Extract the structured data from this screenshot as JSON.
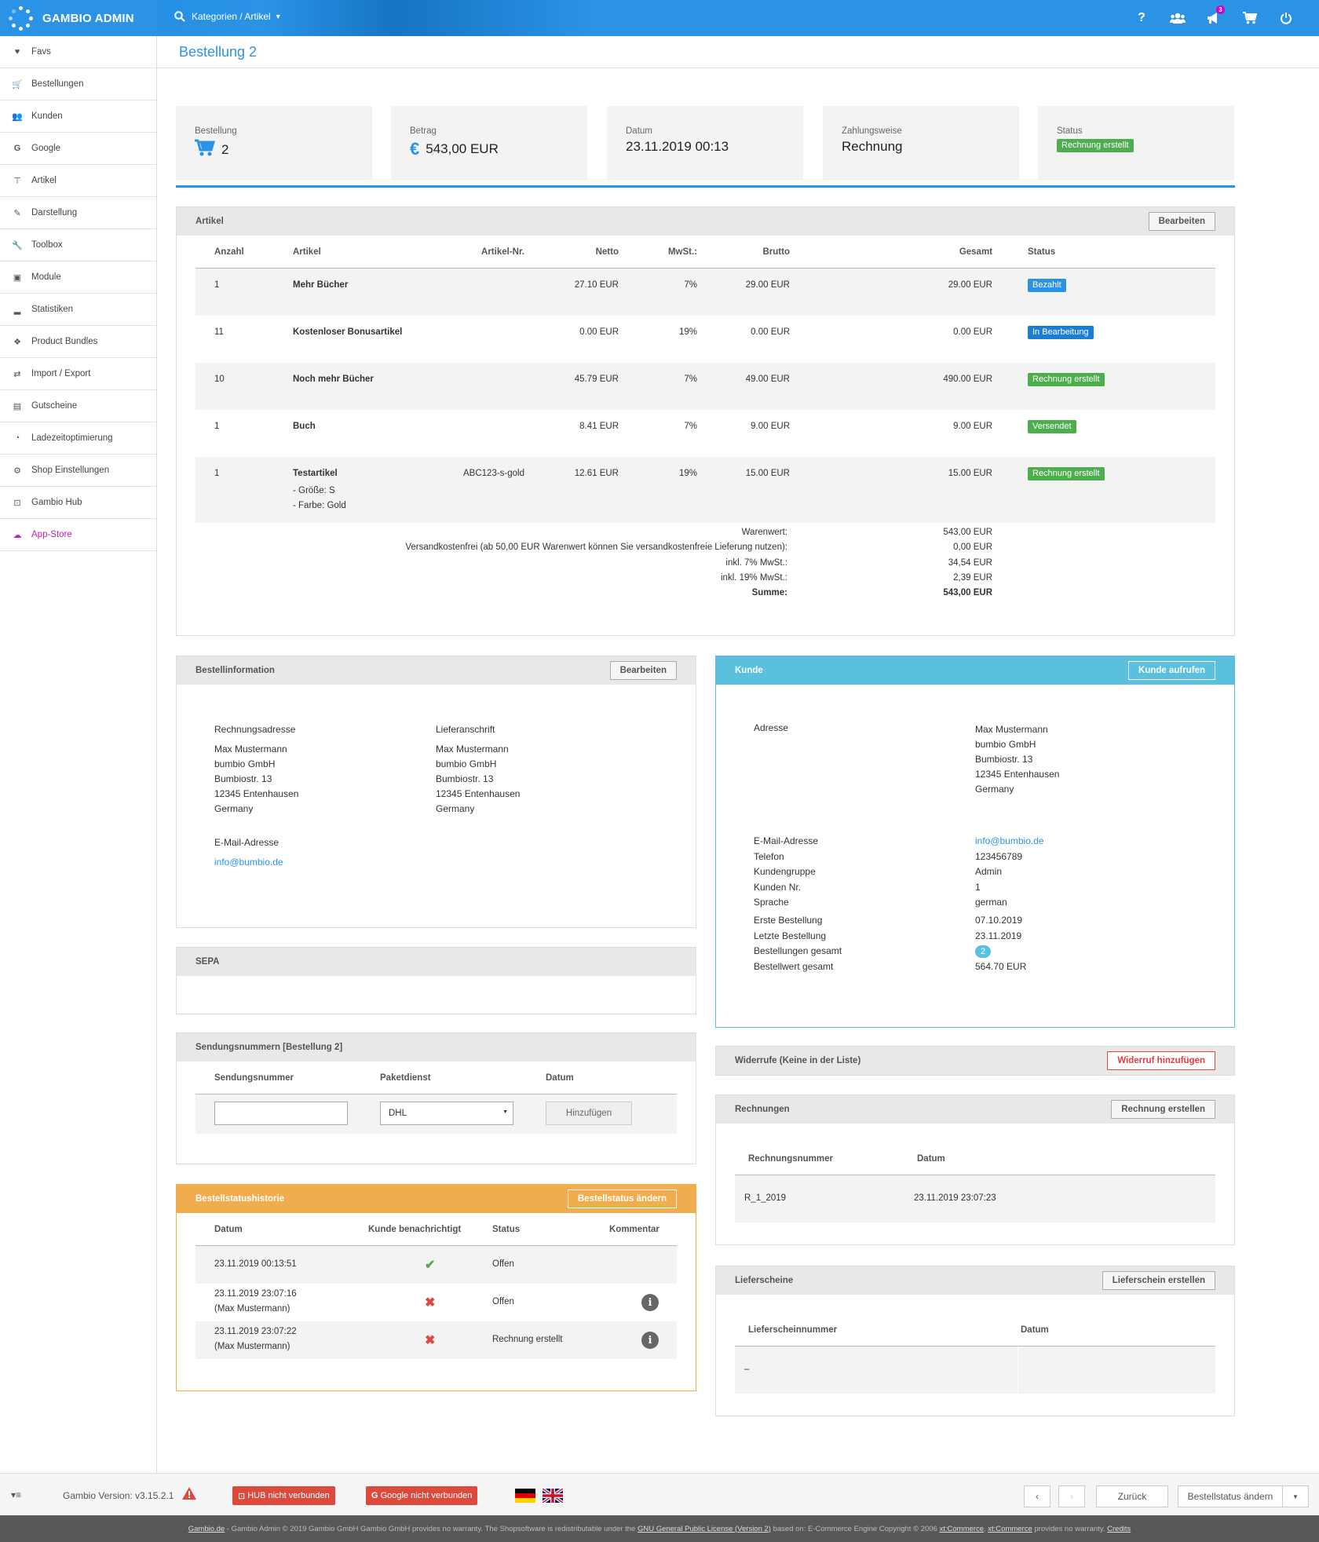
{
  "topbar": {
    "brand": "GAMBIO ADMIN",
    "search_label": "Kategorien / Artikel",
    "notification_count": "3"
  },
  "sidebar": {
    "items": [
      {
        "label": "Favs",
        "icon": "heart-icon"
      },
      {
        "label": "Bestellungen",
        "icon": "cart-icon"
      },
      {
        "label": "Kunden",
        "icon": "users-icon"
      },
      {
        "label": "Google",
        "icon": "google-icon"
      },
      {
        "label": "Artikel",
        "icon": "sitemap-icon"
      },
      {
        "label": "Darstellung",
        "icon": "magic-icon"
      },
      {
        "label": "Toolbox",
        "icon": "wrench-icon"
      },
      {
        "label": "Module",
        "icon": "puzzle-icon"
      },
      {
        "label": "Statistiken",
        "icon": "chart-icon"
      },
      {
        "label": "Product Bundles",
        "icon": "cubes-icon"
      },
      {
        "label": "Import / Export",
        "icon": "exchange-icon"
      },
      {
        "label": "Gutscheine",
        "icon": "gift-icon"
      },
      {
        "label": "Ladezeitoptimierung",
        "icon": "dashboard-icon"
      },
      {
        "label": "Shop Einstellungen",
        "icon": "gears-icon"
      },
      {
        "label": "Gambio Hub",
        "icon": "hub-icon"
      },
      {
        "label": "App-Store",
        "icon": "cloud-download-icon"
      }
    ]
  },
  "page": {
    "title": "Bestellung 2"
  },
  "stats": {
    "bestellung": {
      "label": "Bestellung",
      "value": "2"
    },
    "betrag": {
      "label": "Betrag",
      "value": "543,00 EUR"
    },
    "datum": {
      "label": "Datum",
      "value": "23.11.2019 00:13"
    },
    "zahlungsweise": {
      "label": "Zahlungsweise",
      "value": "Rechnung"
    },
    "status": {
      "label": "Status",
      "value": "Rechnung erstellt"
    }
  },
  "artikel": {
    "title": "Artikel",
    "edit_label": "Bearbeiten",
    "headers": {
      "anzahl": "Anzahl",
      "artikel": "Artikel",
      "nr": "Artikel-Nr.",
      "netto": "Netto",
      "mwst": "MwSt.:",
      "brutto": "Brutto",
      "gesamt": "Gesamt",
      "status": "Status"
    },
    "rows": [
      {
        "anzahl": "1",
        "artikel": "Mehr Bücher",
        "nr": "",
        "netto": "27.10 EUR",
        "mwst": "7%",
        "brutto": "29.00 EUR",
        "gesamt": "29.00 EUR",
        "status": "Bezahlt"
      },
      {
        "anzahl": "11",
        "artikel": "Kostenloser Bonusartikel",
        "nr": "",
        "netto": "0.00 EUR",
        "mwst": "19%",
        "brutto": "0.00 EUR",
        "gesamt": "0.00 EUR",
        "status": "In Bearbeitung"
      },
      {
        "anzahl": "10",
        "artikel": "Noch mehr Bücher",
        "nr": "",
        "netto": "45.79 EUR",
        "mwst": "7%",
        "brutto": "49.00 EUR",
        "gesamt": "490.00 EUR",
        "status": "Rechnung erstellt"
      },
      {
        "anzahl": "1",
        "artikel": "Buch",
        "nr": "",
        "netto": "8.41 EUR",
        "mwst": "7%",
        "brutto": "9.00 EUR",
        "gesamt": "9.00 EUR",
        "status": "Versendet"
      },
      {
        "anzahl": "1",
        "artikel": "Testartikel",
        "nr": "ABC123-s-gold",
        "netto": "12.61 EUR",
        "mwst": "19%",
        "brutto": "15.00 EUR",
        "gesamt": "15.00 EUR",
        "status": "Rechnung erstellt",
        "opt1": "- Größe: S",
        "opt2": "- Farbe: Gold"
      }
    ],
    "totals": [
      {
        "label": "Warenwert:",
        "value": "543,00 EUR"
      },
      {
        "label": "Versandkostenfrei (ab 50,00 EUR Warenwert können Sie versandkostenfreie Lieferung nutzen):",
        "value": "0,00 EUR"
      },
      {
        "label": "inkl. 7% MwSt.:",
        "value": "34,54 EUR"
      },
      {
        "label": "inkl. 19% MwSt.:",
        "value": "2,39 EUR"
      },
      {
        "label": "Summe:",
        "value": "543,00 EUR"
      }
    ]
  },
  "bestellinfo": {
    "title": "Bestellinformation",
    "edit_label": "Bearbeiten",
    "rechnung_label": "Rechnungsadresse",
    "rechnung": [
      "Max Mustermann",
      "bumbio GmbH",
      "Bumbiostr. 13",
      "12345 Entenhausen",
      "Germany"
    ],
    "liefer_label": "Lieferanschrift",
    "liefer": [
      "Max Mustermann",
      "bumbio GmbH",
      "Bumbiostr. 13",
      "12345 Entenhausen",
      "Germany"
    ],
    "email_label": "E-Mail-Adresse",
    "email": "info@bumbio.de"
  },
  "kunde": {
    "title": "Kunde",
    "button": "Kunde aufrufen",
    "adresse_label": "Adresse",
    "adresse": [
      "Max Mustermann",
      "bumbio GmbH",
      "Bumbiostr. 13",
      "12345 Entenhausen",
      "Germany"
    ],
    "fields1": [
      {
        "label": "E-Mail-Adresse",
        "value": "info@bumbio.de"
      },
      {
        "label": "Telefon",
        "value": "123456789"
      },
      {
        "label": "Kundengruppe",
        "value": "Admin"
      },
      {
        "label": "Kunden Nr.",
        "value": "1"
      },
      {
        "label": "Sprache",
        "value": "german"
      }
    ],
    "fields2": [
      {
        "label": "Erste Bestellung",
        "value": "07.10.2019"
      },
      {
        "label": "Letzte Bestellung",
        "value": "23.11.2019"
      },
      {
        "label": "Bestellungen gesamt",
        "value": "2"
      },
      {
        "label": "Bestellwert gesamt",
        "value": "564.70 EUR"
      }
    ]
  },
  "sepa": {
    "title": "SEPA"
  },
  "sendung": {
    "title": "Sendungsnummern [Bestellung 2]",
    "h_nr": "Sendungsnummer",
    "h_dienst": "Paketdienst",
    "h_datum": "Datum",
    "dienst_value": "DHL",
    "add_label": "Hinzufügen"
  },
  "historie": {
    "title": "Bestellstatushistorie",
    "button": "Bestellstatus ändern",
    "h_datum": "Datum",
    "h_kunde": "Kunde benachrichtigt",
    "h_status": "Status",
    "h_kommentar": "Kommentar",
    "rows": [
      {
        "datum": "23.11.2019 00:13:51",
        "sub": "",
        "notified": true,
        "status": "Offen",
        "comment": false
      },
      {
        "datum": "23.11.2019 23:07:16",
        "sub": "(Max Mustermann)",
        "notified": false,
        "status": "Offen",
        "comment": true
      },
      {
        "datum": "23.11.2019 23:07:22",
        "sub": "(Max Mustermann)",
        "notified": false,
        "status": "Rechnung erstellt",
        "comment": true
      }
    ]
  },
  "widerrufe": {
    "title": "Widerrufe (Keine in der Liste)",
    "button": "Widerruf hinzufügen"
  },
  "rechnungen": {
    "title": "Rechnungen",
    "button": "Rechnung erstellen",
    "h_nr": "Rechnungsnummer",
    "h_datum": "Datum",
    "nr": "R_1_2019",
    "datum": "23.11.2019 23:07:23"
  },
  "lieferscheine": {
    "title": "Lieferscheine",
    "button": "Lieferschein erstellen",
    "h_nr": "Lieferscheinnummer",
    "h_datum": "Datum",
    "nr": "–"
  },
  "footer": {
    "version": "Gambio Version: v3.15.2.1",
    "hub": "HUB nicht verbunden",
    "google": "Google nicht verbunden",
    "back": "Zurück",
    "status_change": "Bestellstatus ändern",
    "copyright_a": "Gambio.de",
    "copyright_b": " - Gambio Admin © 2019 Gambio GmbH Gambio GmbH provides no warranty. The Shopsoftware is redistributable under the ",
    "copyright_c": "GNU General Public License (Version 2)",
    "copyright_d": " based on: E-Commerce Engine Copyright © 2006 ",
    "copyright_e": "xt:Commerce",
    "copyright_f": ", ",
    "copyright_g": "xt:Commerce",
    "copyright_h": " provides no warranty.  ",
    "copyright_i": "Credits"
  }
}
